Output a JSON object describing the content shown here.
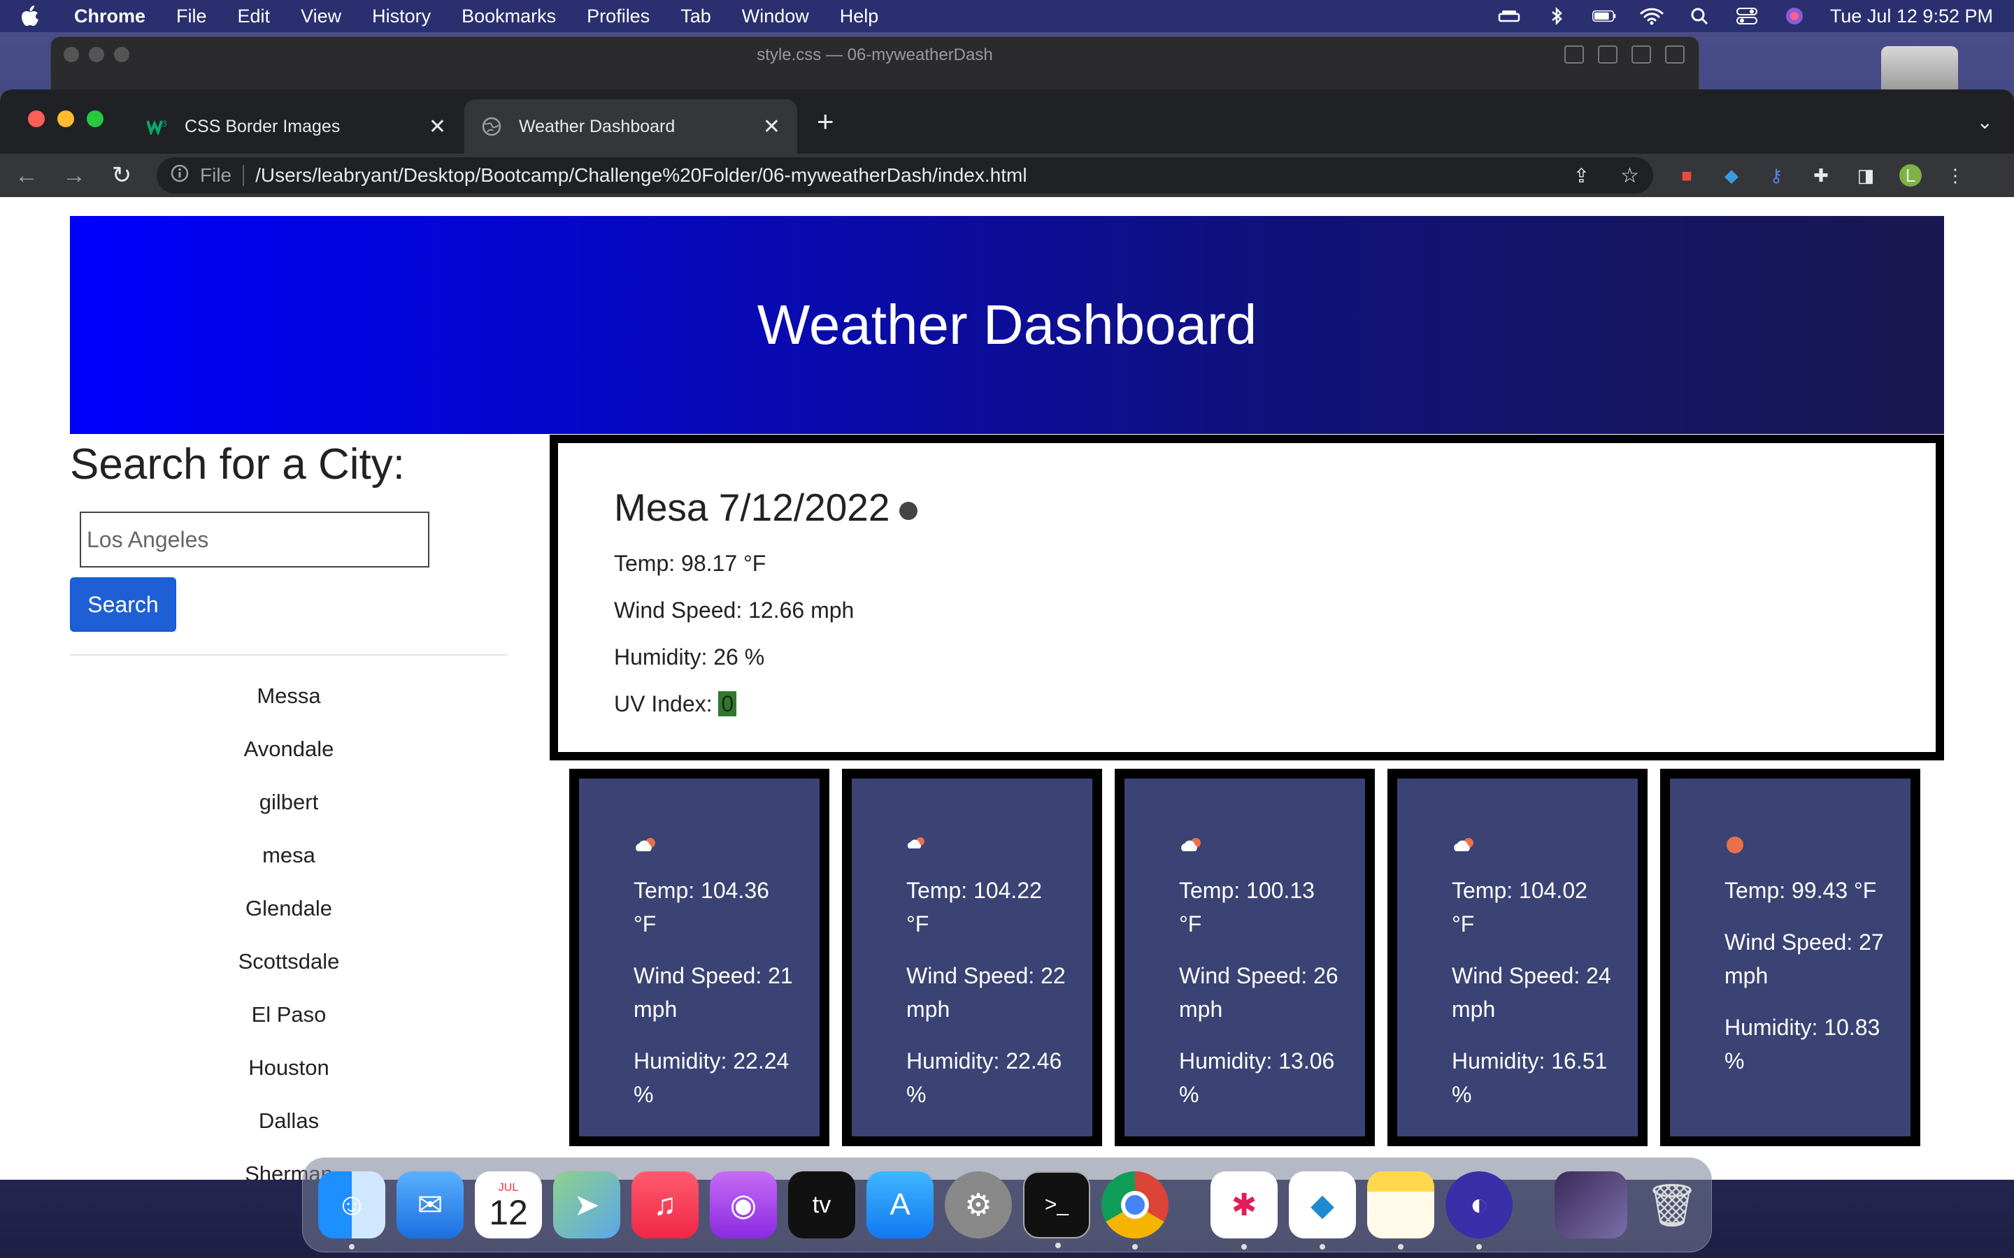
{
  "menubar": {
    "app_name": "Chrome",
    "items": [
      "File",
      "Edit",
      "View",
      "History",
      "Bookmarks",
      "Profiles",
      "Tab",
      "Window",
      "Help"
    ],
    "clock": "Tue Jul 12  9:52 PM"
  },
  "background_window": {
    "title": "style.css — 06-myweatherDash"
  },
  "browser": {
    "tabs": [
      {
        "title": "CSS Border Images",
        "active": false
      },
      {
        "title": "Weather Dashboard",
        "active": true
      }
    ],
    "address": {
      "scheme_label": "File",
      "url": "/Users/leabryant/Desktop/Bootcamp/Challenge%20Folder/06-myweatherDash/index.html"
    },
    "profile_initial": "L"
  },
  "page": {
    "header_title": "Weather Dashboard",
    "search": {
      "heading": "Search for a City:",
      "placeholder": "Los Angeles",
      "button_label": "Search"
    },
    "history": [
      "Messa",
      "Avondale",
      "gilbert",
      "mesa",
      "Glendale",
      "Scottsdale",
      "El Paso",
      "Houston",
      "Dallas",
      "Sherman"
    ],
    "current": {
      "city_date": "Mesa 7/12/2022",
      "temp": "Temp: 98.17 °F",
      "wind": "Wind Speed: 12.66 mph",
      "humidity": "Humidity: 26 %",
      "uv_label": "UV Index:",
      "uv_value": "0",
      "uv_color": "#2d7a2d"
    },
    "forecast": [
      {
        "icon": "partly-cloudy-icon",
        "temp": "Temp: 104.36 °F",
        "wind": "Wind Speed: 21 mph",
        "humidity": "Humidity: 22.24 %"
      },
      {
        "icon": "partly-cloudy-icon",
        "temp": "Temp: 104.22 °F",
        "wind": "Wind Speed: 22 mph",
        "humidity": "Humidity: 22.46 %"
      },
      {
        "icon": "partly-cloudy-icon",
        "temp": "Temp: 100.13 °F",
        "wind": "Wind Speed: 26 mph",
        "humidity": "Humidity: 13.06 %"
      },
      {
        "icon": "partly-cloudy-icon",
        "temp": "Temp: 104.02 °F",
        "wind": "Wind Speed: 24 mph",
        "humidity": "Humidity: 16.51 %"
      },
      {
        "icon": "sun-icon",
        "temp": "Temp: 99.43 °F",
        "wind": "Wind Speed: 27 mph",
        "humidity": "Humidity: 10.83 %"
      }
    ]
  },
  "dock": {
    "calendar_month": "JUL",
    "calendar_day": "12"
  },
  "colors": {
    "header_gradient_start": "#0000ff",
    "header_gradient_end": "#1a1850",
    "forecast_card_bg": "#3a4373",
    "search_button": "#1e5fd6"
  }
}
